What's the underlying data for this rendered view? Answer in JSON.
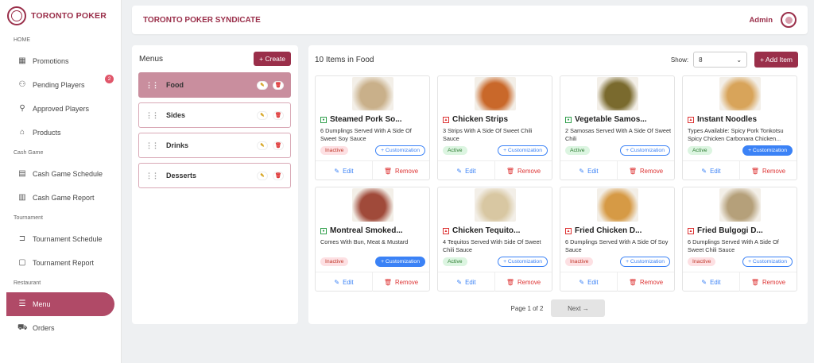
{
  "brand": {
    "name": "TORONTO POKER"
  },
  "sidebar": {
    "sections": [
      {
        "label": "HOME",
        "items": [
          {
            "label": "Promotions",
            "icon": "grid-icon"
          },
          {
            "label": "Pending Players",
            "icon": "users-icon",
            "badge": "2"
          },
          {
            "label": "Approved Players",
            "icon": "user-icon"
          },
          {
            "label": "Products",
            "icon": "store-icon"
          }
        ]
      },
      {
        "label": "Cash Game",
        "items": [
          {
            "label": "Cash Game Schedule",
            "icon": "calendar-icon"
          },
          {
            "label": "Cash Game Report",
            "icon": "calendar-report-icon"
          }
        ]
      },
      {
        "label": "Tournament",
        "items": [
          {
            "label": "Tournament Schedule",
            "icon": "bracket-icon"
          },
          {
            "label": "Tournament Report",
            "icon": "clipboard-icon"
          }
        ]
      },
      {
        "label": "Restaurant",
        "items": [
          {
            "label": "Menu",
            "icon": "menu-icon",
            "active": true
          },
          {
            "label": "Orders",
            "icon": "cart-icon"
          }
        ]
      }
    ]
  },
  "header": {
    "title": "TORONTO POKER SYNDICATE",
    "user": "Admin"
  },
  "menus": {
    "title": "Menus",
    "create_label": "+ Create",
    "items": [
      {
        "label": "Food",
        "active": true
      },
      {
        "label": "Sides"
      },
      {
        "label": "Drinks"
      },
      {
        "label": "Desserts"
      }
    ]
  },
  "main": {
    "title": "10 Items in Food",
    "show_label": "Show:",
    "show_value": "8",
    "add_label": "+ Add Item",
    "edit_label": "Edit",
    "remove_label": "Remove",
    "customization_label": "+ Customization",
    "items": [
      {
        "title": "Steamed Pork So...",
        "desc": "6 Dumplings Served With A Side Of Sweet Soy Sauce",
        "status": "Inactive",
        "veg": true,
        "cust_filled": false,
        "color": "#c9b08a"
      },
      {
        "title": "Chicken Strips",
        "desc": "3 Strips With A Side Of Sweet Chili Sauce",
        "status": "Active",
        "veg": false,
        "cust_filled": false,
        "color": "#c9682a"
      },
      {
        "title": "Vegetable Samos...",
        "desc": "2 Samosas Served With A Side Of Sweet Chili",
        "status": "Active",
        "veg": true,
        "cust_filled": false,
        "color": "#7a6a2e"
      },
      {
        "title": "Instant Noodles",
        "desc": "Types Available: Spicy Pork Tonkotsu Spicy Chicken Carbonara Chicken...",
        "status": "Active",
        "veg": false,
        "cust_filled": true,
        "color": "#d8a45a"
      },
      {
        "title": "Montreal Smoked...",
        "desc": "Comes With Bun, Meat & Mustard",
        "status": "Inactive",
        "veg": true,
        "cust_filled": true,
        "color": "#a04a3a"
      },
      {
        "title": "Chicken Tequito...",
        "desc": "4 Tequitos Served With Side Of Sweet Chili Sauce",
        "status": "Active",
        "veg": false,
        "cust_filled": false,
        "color": "#d8c7a2"
      },
      {
        "title": "Fried Chicken D...",
        "desc": "6 Dumplings Served With A Side Of Soy Sauce",
        "status": "Inactive",
        "veg": false,
        "cust_filled": false,
        "color": "#d69a45"
      },
      {
        "title": "Fried Bulgogi D...",
        "desc": "6 Dumplings Served With A Side Of Sweet Chili Sauce",
        "status": "Inactive",
        "veg": false,
        "cust_filled": false,
        "color": "#b5a07a"
      }
    ]
  },
  "pager": {
    "info": "Page 1 of 2",
    "next_label": "Next →"
  }
}
